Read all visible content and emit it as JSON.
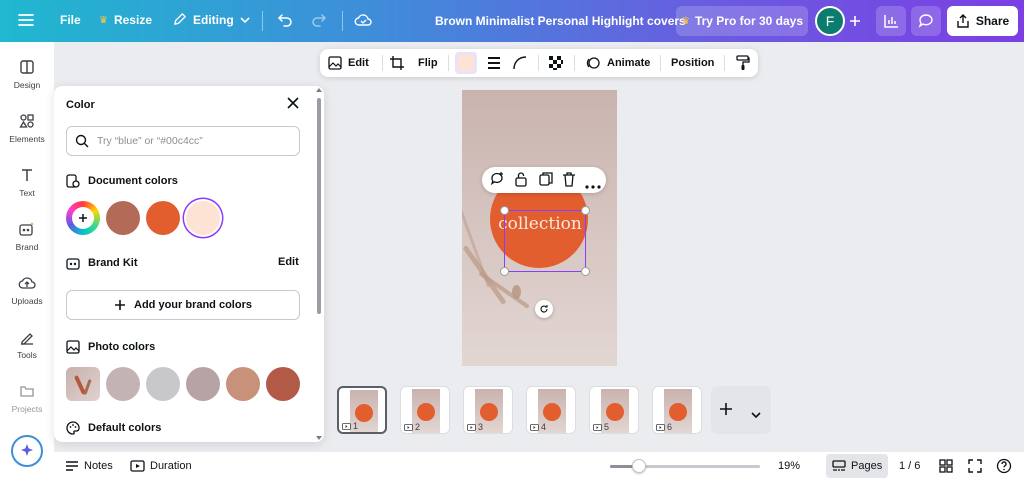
{
  "topbar": {
    "file": "File",
    "resize": "Resize",
    "mode": "Editing",
    "doc_title": "Brown Minimalist Personal Highlight covers",
    "try_pro": "Try Pro for 30 days",
    "avatar_initial": "F",
    "share": "Share"
  },
  "rail": [
    {
      "label": "Design",
      "icon": "design-icon"
    },
    {
      "label": "Elements",
      "icon": "elements-icon"
    },
    {
      "label": "Text",
      "icon": "text-icon"
    },
    {
      "label": "Brand",
      "icon": "brand-icon"
    },
    {
      "label": "Uploads",
      "icon": "uploads-icon"
    },
    {
      "label": "Tools",
      "icon": "tools-icon"
    },
    {
      "label": "Projects",
      "icon": "projects-icon"
    }
  ],
  "panel": {
    "title": "Color",
    "search_placeholder": "Try “blue” or “#00c4cc”",
    "document_colors": "Document colors",
    "brand_kit": "Brand Kit",
    "brand_edit": "Edit",
    "add_brand": "Add your brand colors",
    "photo_colors": "Photo colors",
    "default_colors": "Default colors",
    "doc_swatches": [
      "#b36a57",
      "#e25e2f",
      "#fde3d3"
    ],
    "photo_swatches": [
      "#c3b4b3",
      "#c8c8ca",
      "#b7a2a4",
      "#c8917a",
      "#b35a47"
    ]
  },
  "toolbar": {
    "edit": "Edit",
    "flip": "Flip",
    "animate": "Animate",
    "position": "Position",
    "current_color": "#fde3d3"
  },
  "canvas": {
    "text": "collection"
  },
  "pages": [
    "1",
    "2",
    "3",
    "4",
    "5",
    "6"
  ],
  "bottombar": {
    "notes": "Notes",
    "duration": "Duration",
    "zoom": "19%",
    "zoom_fraction": 0.19,
    "pages_label": "Pages",
    "page_count": "1 / 6"
  }
}
